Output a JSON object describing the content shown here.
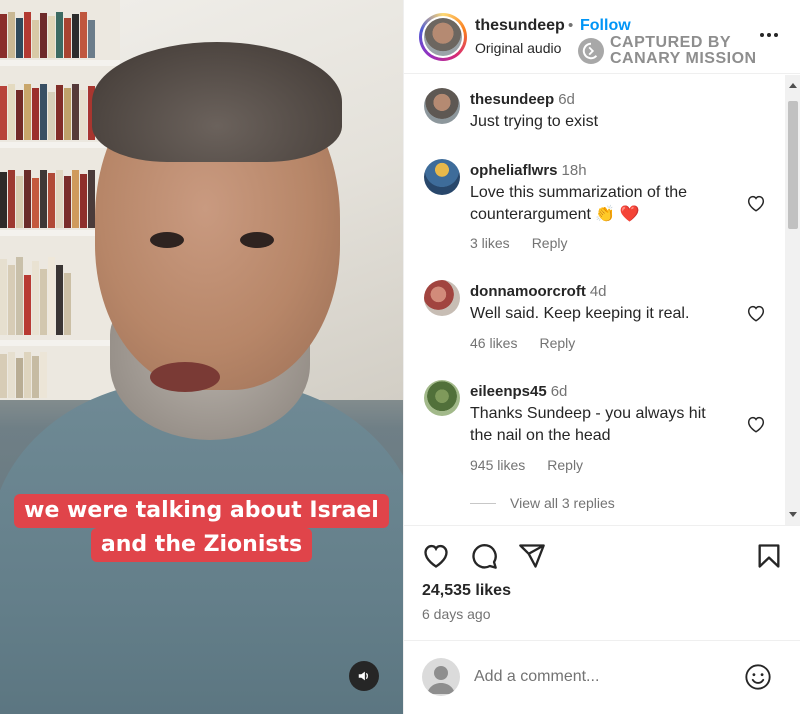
{
  "video": {
    "caption_lines": [
      "we were talking about Israel",
      "and the Zionists"
    ],
    "audio_icon": "speaker-icon"
  },
  "header": {
    "username": "thesundeep",
    "separator": "•",
    "follow_label": "Follow",
    "audio_label": "Original audio",
    "watermark_line1": "CAPTURED BY",
    "watermark_line2": "CANARY MISSION",
    "more_icon": "more-options-icon"
  },
  "comments": [
    {
      "user": "thesundeep",
      "time": "6d",
      "text": "Just trying to exist",
      "likes": "",
      "reply": ""
    },
    {
      "user": "opheliaflwrs",
      "time": "18h",
      "text": "Love this summarization of the counterargument 👏 ❤️",
      "likes": "3 likes",
      "reply": "Reply"
    },
    {
      "user": "donnamoorcroft",
      "time": "4d",
      "text": "Well said. Keep keeping it real.",
      "likes": "46 likes",
      "reply": "Reply"
    },
    {
      "user": "eileenps45",
      "time": "6d",
      "text": "Thanks Sundeep - you always hit the nail on the head",
      "likes": "945 likes",
      "reply": "Reply"
    }
  ],
  "view_replies": "View all 3 replies",
  "actions": {
    "like_icon": "heart-icon",
    "comment_icon": "comment-icon",
    "share_icon": "share-icon",
    "save_icon": "bookmark-icon",
    "likes": "24,535 likes",
    "posted": "6 days ago"
  },
  "add_comment": {
    "placeholder": "Add a comment...",
    "emoji_icon": "emoji-icon"
  },
  "colors": {
    "follow": "#0095f6",
    "caption_bg": "#e0444a",
    "muted": "#737373"
  }
}
